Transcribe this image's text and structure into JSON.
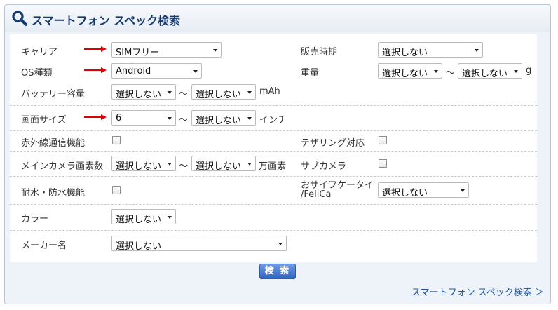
{
  "header": {
    "title": "スマートフォン スペック検索",
    "icon": "search-icon"
  },
  "accent_color": "#153a6b",
  "arrow_color": "#e00000",
  "rows": {
    "carrier": {
      "label": "キャリア",
      "value": "SIMフリー"
    },
    "sales_period": {
      "label": "販売時期",
      "value": "選択しない"
    },
    "os": {
      "label": "OS種類",
      "value": "Android"
    },
    "weight": {
      "label": "重量",
      "from": "選択しない",
      "tilde": "～",
      "to": "選択しない",
      "unit": "g"
    },
    "battery": {
      "label": "バッテリー容量",
      "from": "選択しない",
      "tilde": "～",
      "to": "選択しない",
      "unit": "mAh"
    },
    "screen": {
      "label": "画面サイズ",
      "from": "6",
      "tilde": "～",
      "to": "選択しない",
      "unit": "インチ"
    },
    "infrared": {
      "label": "赤外線通信機能",
      "checked": false
    },
    "tethering": {
      "label": "テザリング対応",
      "checked": false
    },
    "main_camera": {
      "label": "メインカメラ画素数",
      "from": "選択しない",
      "tilde": "～",
      "to": "選択しない",
      "unit": "万画素"
    },
    "sub_camera": {
      "label": "サブカメラ",
      "checked": false
    },
    "waterproof": {
      "label": "耐水・防水機能",
      "checked": false
    },
    "osaifu": {
      "label_line1": "おサイフケータイ",
      "label_line2": "/FeliCa",
      "value": "選択しない"
    },
    "color": {
      "label": "カラー",
      "value": "選択しない"
    },
    "maker": {
      "label": "メーカー名",
      "value": "選択しない"
    }
  },
  "search_button": "検 索",
  "footer_link": "スマートフォン スペック検索 ＞"
}
